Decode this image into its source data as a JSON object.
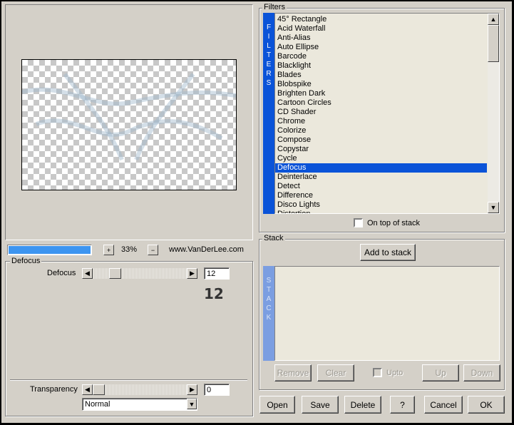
{
  "preview": {
    "zoom_plus": "+",
    "zoom_value": "33%",
    "zoom_minus": "−",
    "website": "www.VanDerLee.com",
    "progress_fraction": 1.0
  },
  "defocus_group": {
    "title": "Defocus",
    "slider_label": "Defocus",
    "slider_value": "12",
    "big_value": "12",
    "slider_fraction": 0.2
  },
  "transparency": {
    "label": "Transparency",
    "value": "0",
    "slider_fraction": 0.0,
    "blend_mode": "Normal"
  },
  "filters": {
    "title": "Filters",
    "side_letters": [
      "F",
      "I",
      "L",
      "T",
      "E",
      "R",
      "S"
    ],
    "items": [
      "45° Rectangle",
      "Acid Waterfall",
      "Anti-Alias",
      "Auto Ellipse",
      "Barcode",
      "Blacklight",
      "Blades",
      "Blobspike",
      "Brighten Dark",
      "Cartoon Circles",
      "CD Shader",
      "Chrome",
      "Colorize",
      "Compose",
      "Copystar",
      "Cycle",
      "Defocus",
      "Deinterlace",
      "Detect",
      "Difference",
      "Disco Lights",
      "Distortion"
    ],
    "selected": "Defocus",
    "on_top_label": "On top of stack"
  },
  "stack": {
    "title": "Stack",
    "add_button": "Add to stack",
    "side_letters": [
      "S",
      "T",
      "A",
      "C",
      "K"
    ],
    "remove": "Remove",
    "clear": "Clear",
    "upto": "Upto",
    "up": "Up",
    "down": "Down"
  },
  "footer": {
    "open": "Open",
    "save": "Save",
    "delete": "Delete",
    "help": "?",
    "cancel": "Cancel",
    "ok": "OK"
  }
}
